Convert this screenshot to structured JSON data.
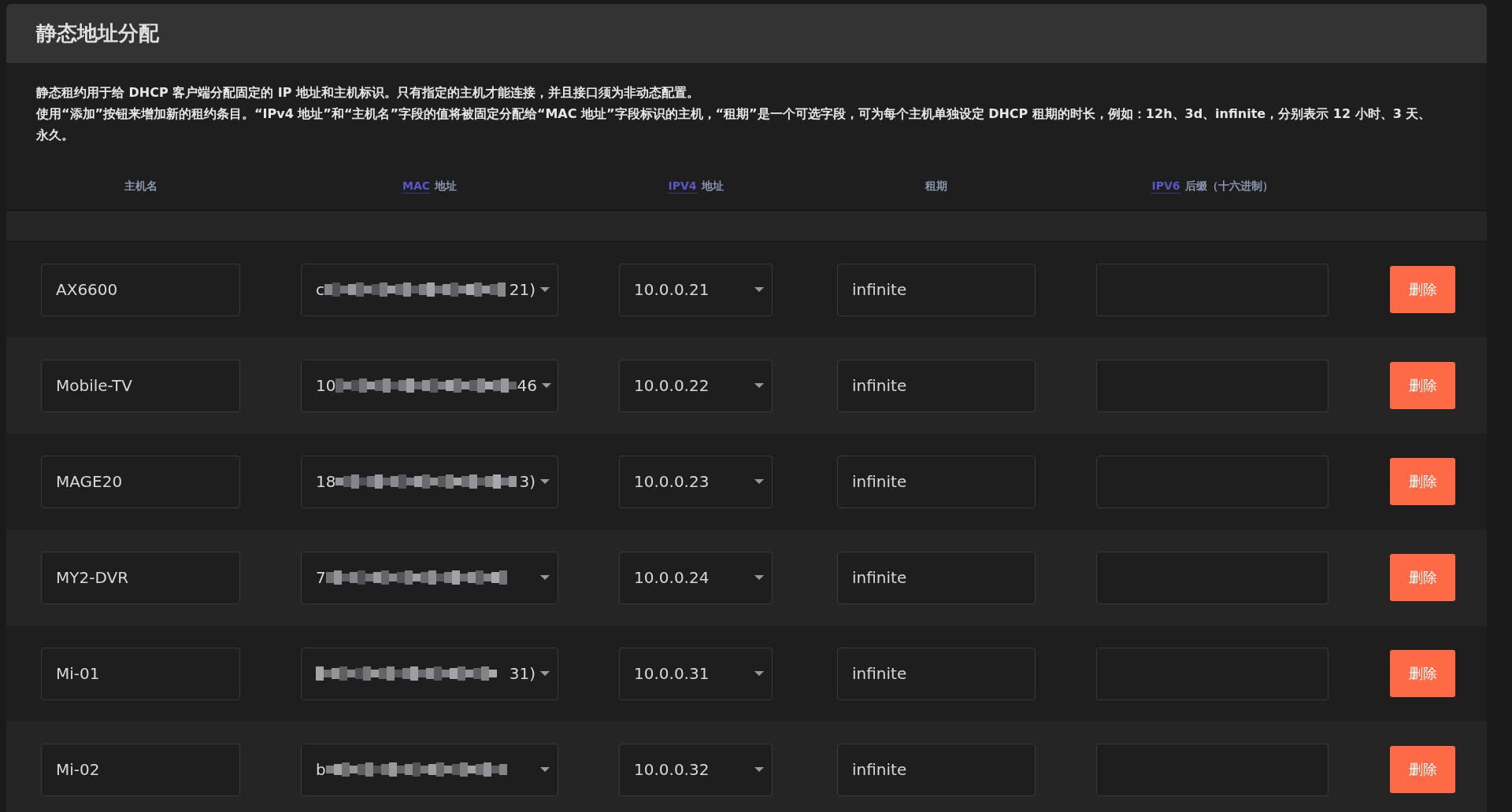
{
  "panel": {
    "title": "静态地址分配",
    "description": [
      "静态租约用于给 DHCP 客户端分配固定的 IP 地址和主机标识。只有指定的主机才能连接，并且接口须为非动态配置。",
      "使用“添加”按钮来增加新的租约条目。“IPv4 地址”和“主机名”字段的值将被固定分配给“MAC 地址”字段标识的主机，“租期”是一个可选字段，可为每个主机单独设定 DHCP 租期的时长，例如：12h、3d、infinite，分别表示 12 小时、3 天、永久。"
    ]
  },
  "table": {
    "columns": [
      {
        "label": "主机名"
      },
      {
        "abbr": "MAC",
        "label": "地址"
      },
      {
        "abbr": "IPV4",
        "label": "地址"
      },
      {
        "label": "租期"
      },
      {
        "abbr": "IPV6",
        "label": "后缀（十六进制）"
      }
    ],
    "rows": [
      {
        "hostname": "AX6600",
        "mac": {
          "prefix": "c",
          "suffix": "21)"
        },
        "ipv4": "10.0.0.21",
        "lease": "infinite",
        "button": "删除"
      },
      {
        "hostname": "Mobile-TV",
        "mac": {
          "prefix": "10",
          "suffix": "46"
        },
        "ipv4": "10.0.0.22",
        "lease": "infinite",
        "button": "删除"
      },
      {
        "hostname": "MAGE20",
        "mac": {
          "prefix": "18",
          "suffix": "3)"
        },
        "ipv4": "10.0.0.23",
        "lease": "infinite",
        "button": "删除"
      },
      {
        "hostname": "MY2-DVR",
        "mac": {
          "prefix": "7"
        },
        "ipv4": "10.0.0.24",
        "lease": "infinite",
        "button": "删除"
      },
      {
        "hostname": "Mi-01",
        "mac": {
          "suffix": "31)"
        },
        "ipv4": "10.0.0.31",
        "lease": "infinite",
        "button": "删除"
      },
      {
        "hostname": "Mi-02",
        "mac": {
          "prefix": "b"
        },
        "ipv4": "10.0.0.32",
        "lease": "infinite",
        "button": "删除"
      }
    ]
  }
}
